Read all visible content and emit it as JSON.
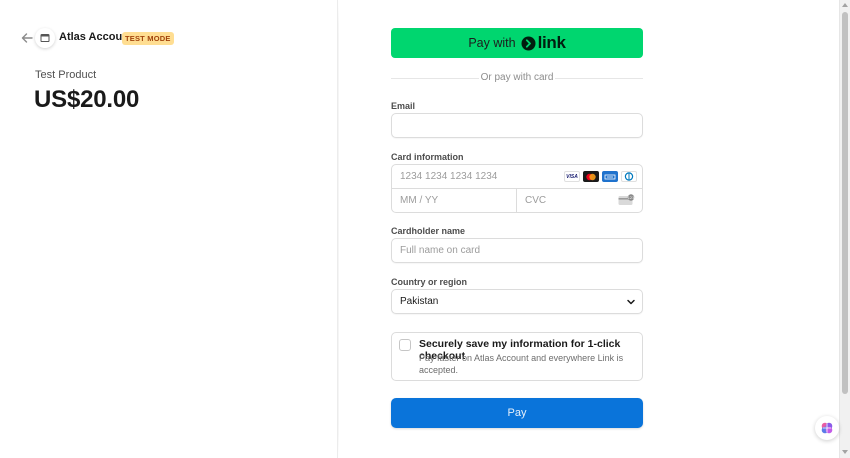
{
  "merchant": {
    "name": "Atlas Account",
    "badge": "TEST MODE",
    "icons": {
      "back": "back-arrow-icon",
      "store": "store-icon"
    }
  },
  "product": {
    "name": "Test Product",
    "price": "US$20.00"
  },
  "link_button": {
    "label": "Pay with",
    "logo_text": "link",
    "color": "#00d66f"
  },
  "divider": {
    "text": "Or pay with card"
  },
  "email": {
    "label": "Email",
    "value": "",
    "placeholder": ""
  },
  "card": {
    "label": "Card information",
    "number_placeholder": "1234 1234 1234 1234",
    "expiry_placeholder": "MM / YY",
    "cvc_placeholder": "CVC",
    "brands": [
      "VISA",
      "mastercard",
      "amex",
      "diners"
    ]
  },
  "cardholder": {
    "label": "Cardholder name",
    "placeholder": "Full name on card"
  },
  "country": {
    "label": "Country or region",
    "selected": "Pakistan"
  },
  "save_info": {
    "checked": false,
    "title": "Securely save my information for 1-click checkout",
    "description": "Pay faster on Atlas Account and everywhere Link is accepted."
  },
  "pay_button": {
    "label": "Pay",
    "color": "#0a74da"
  },
  "colors": {
    "accent": "#0a74da",
    "link_green": "#00d66f",
    "badge_bg": "#ffde92",
    "badge_text": "#a2440c"
  }
}
